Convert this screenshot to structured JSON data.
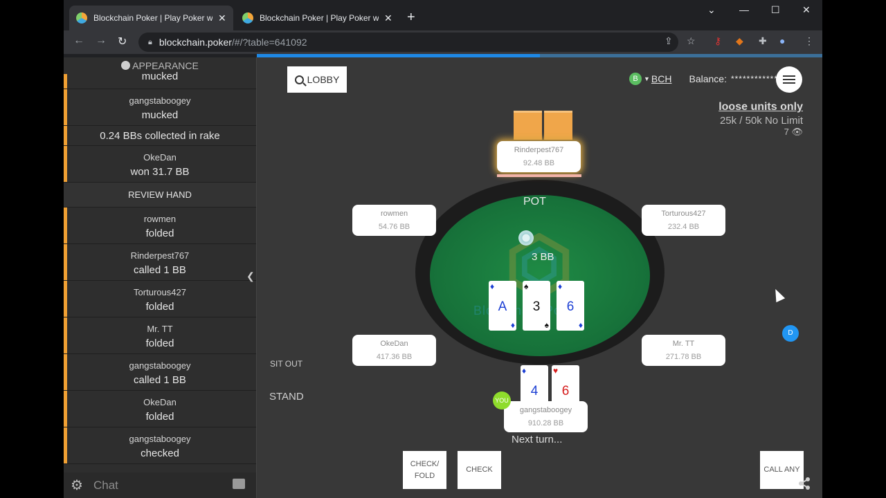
{
  "tabs": [
    {
      "title": "Blockchain Poker | Play Poker with",
      "active": true
    },
    {
      "title": "Blockchain Poker | Play Poker with",
      "active": false
    }
  ],
  "address": {
    "domain": "blockchain.poker",
    "path": "/#/?table=641092"
  },
  "sidebar": {
    "appearance_label": "APPEARANCE",
    "log_top": [
      {
        "who": "",
        "action": "mucked"
      },
      {
        "who": "gangstaboogey",
        "action": "mucked"
      }
    ],
    "rake": "0.24 BBs collected in rake",
    "winner": {
      "who": "OkeDan",
      "action": "won 31.7 BB"
    },
    "review_label": "REVIEW HAND",
    "log": [
      {
        "who": "rowmen",
        "action": "folded"
      },
      {
        "who": "Rinderpest767",
        "action": "called 1 BB"
      },
      {
        "who": "Torturous427",
        "action": "folded"
      },
      {
        "who": "Mr. TT",
        "action": "folded"
      },
      {
        "who": "gangstaboogey",
        "action": "called 1 BB"
      },
      {
        "who": "OkeDan",
        "action": "folded"
      },
      {
        "who": "gangstaboogey",
        "action": "checked"
      }
    ],
    "chat_placeholder": "Chat"
  },
  "header": {
    "lobby_label": "LOBBY",
    "coin_symbol": "B",
    "currency": "BCH",
    "balance_label": "Balance:",
    "balance_masked": "************"
  },
  "table_info": {
    "name": "loose units only",
    "stakes": "25k / 50k No Limit",
    "watchers": "7"
  },
  "pot": {
    "label": "POT",
    "amount": "3 BB"
  },
  "board": [
    {
      "rank": "A",
      "suit": "♦",
      "color": "#1c3fd4"
    },
    {
      "rank": "3",
      "suit": "♠",
      "color": "#111111"
    },
    {
      "rank": "6",
      "suit": "♦",
      "color": "#1c3fd4"
    }
  ],
  "hero_cards": [
    {
      "rank": "4",
      "suit": "♦",
      "color": "#1c3fd4"
    },
    {
      "rank": "6",
      "suit": "♥",
      "color": "#d61d1d"
    }
  ],
  "seats": {
    "top": {
      "name": "Rinderpest767",
      "stack": "92.48 BB"
    },
    "upper_left": {
      "name": "rowmen",
      "stack": "54.76 BB"
    },
    "upper_right": {
      "name": "Torturous427",
      "stack": "232.4 BB"
    },
    "lower_left": {
      "name": "OkeDan",
      "stack": "417.36 BB"
    },
    "lower_right": {
      "name": "Mr. TT",
      "stack": "271.78 BB"
    },
    "hero": {
      "name": "gangstaboogey",
      "stack": "910.28 BB"
    }
  },
  "dealer_label": "D",
  "you_label": "YOU",
  "sit_out_label": "SIT OUT",
  "stand_label": "STAND",
  "status": "Next turn...",
  "actions": {
    "check_fold": "CHECK/ FOLD",
    "check": "CHECK",
    "call_any": "CALL ANY"
  }
}
